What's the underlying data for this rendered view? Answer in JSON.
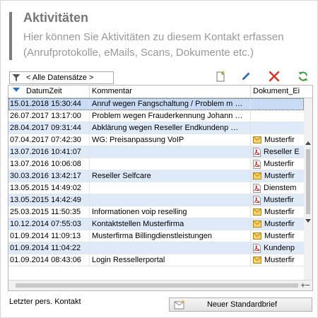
{
  "header": {
    "title": "Aktivitäten",
    "subtitle_line1": "Hier können Sie Aktivitäten zu diesem Kontakt erfassen",
    "subtitle_line2": "(Anrufprotokolle, eMails, Scans, Dokumente etc.)"
  },
  "toolbar": {
    "filter_label": "< Alle Datensätze >",
    "icons": [
      "new-document-icon",
      "edit-pencil-icon",
      "delete-x-icon",
      "refresh-icon"
    ],
    "colors": {
      "pencil": "#2e6fbf",
      "delete": "#e03020",
      "refresh": "#3a9a3a"
    }
  },
  "grid": {
    "columns": [
      "DatumZeit",
      "Kommentar",
      "Dokument_Ei"
    ],
    "rows": [
      {
        "date": "15.01.2018 15:30:44",
        "comment": "Anruf wegen Fangschaltung / Problem m …",
        "doc": "",
        "icon": ""
      },
      {
        "date": "26.07.2017 13:17:00",
        "comment": "Problem wegen Frauderkennung Johann …",
        "doc": "",
        "icon": ""
      },
      {
        "date": "28.04.2017 09:31:44",
        "comment": "Abklärung wegen Reseller Endkundenp …",
        "doc": "",
        "icon": ""
      },
      {
        "date": "07.04.2017 07:42:30",
        "comment": "WG: Preisanpassung VoIP",
        "doc": "Musterfir",
        "icon": "mail"
      },
      {
        "date": "13.07.2016 10:41:07",
        "comment": "",
        "doc": "Reseller E",
        "icon": "pdf"
      },
      {
        "date": "13.07.2016 10:06:08",
        "comment": "",
        "doc": "Musterfir",
        "icon": "pdf"
      },
      {
        "date": "30.03.2016 13:42:17",
        "comment": "Reseller Selfcare",
        "doc": "Musterfir",
        "icon": "mail"
      },
      {
        "date": "13.05.2015 14:49:02",
        "comment": "",
        "doc": "Dienstem",
        "icon": "pdf"
      },
      {
        "date": "13.05.2015 14:42:49",
        "comment": "",
        "doc": "Musterfir",
        "icon": "pdf"
      },
      {
        "date": "25.03.2015 11:50:35",
        "comment": "Informationen voip reselling",
        "doc": "Musterfir",
        "icon": "mail"
      },
      {
        "date": "10.12.2014 07:55:03",
        "comment": "Kontaktstellen Musterfirma",
        "doc": "Musterfir",
        "icon": "mail"
      },
      {
        "date": "01.09.2014 11:09:13",
        "comment": "Musterfirma Billingdienstleistungen",
        "doc": "Musterfir",
        "icon": "mail"
      },
      {
        "date": "01.09.2014 11:04:22",
        "comment": "",
        "doc": "Kundenp",
        "icon": "pdf"
      },
      {
        "date": "01.09.2014 08:43:06",
        "comment": "Login Ressellerportal",
        "doc": "Musterfir",
        "icon": "mail"
      }
    ]
  },
  "footer": {
    "last_contact_label": "Letzter pers. Kontakt",
    "new_letter_button": "Neuer Standardbrief"
  }
}
